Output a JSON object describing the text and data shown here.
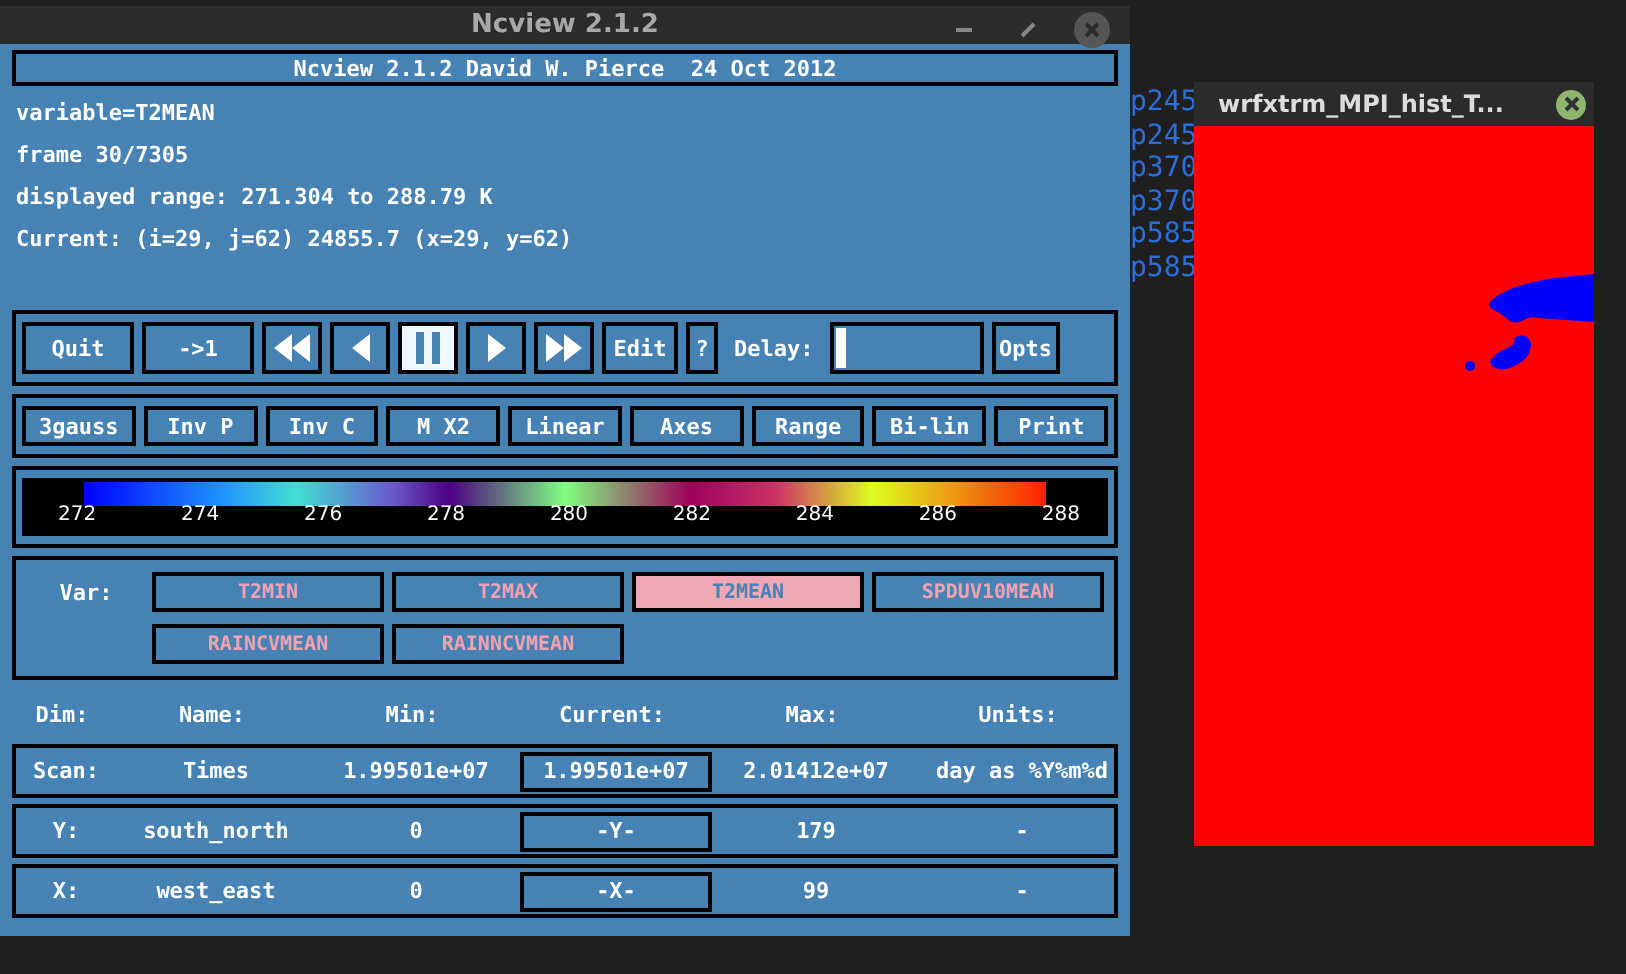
{
  "window": {
    "title": "Ncview 2.1.2"
  },
  "banner": "Ncview 2.1.2 David W. Pierce  24 Oct 2012",
  "info_lines": [
    "variable=T2MEAN",
    "frame 30/7305",
    "displayed range: 271.304 to 288.79 K",
    "Current: (i=29, j=62) 24855.7 (x=29, y=62)"
  ],
  "controls": [
    {
      "kind": "text",
      "label": "Quit"
    },
    {
      "kind": "text",
      "label": "->1"
    },
    {
      "kind": "rewind",
      "selected": false
    },
    {
      "kind": "back",
      "selected": false
    },
    {
      "kind": "pause",
      "selected": true
    },
    {
      "kind": "forward",
      "selected": false
    },
    {
      "kind": "fastforward",
      "selected": false
    },
    {
      "kind": "text",
      "label": "Edit"
    },
    {
      "kind": "text",
      "label": "?"
    },
    {
      "kind": "label",
      "label": "Delay:"
    },
    {
      "kind": "slider",
      "level": 0.04
    },
    {
      "kind": "text",
      "label": "Opts"
    }
  ],
  "options": [
    "3gauss",
    "Inv P",
    "Inv C",
    "M X2",
    "Linear",
    "Axes",
    "Range",
    "Bi-lin",
    "Print"
  ],
  "colorbar": {
    "labels": [
      "272",
      "274",
      "276",
      "278",
      "280",
      "282",
      "284",
      "286",
      "288"
    ]
  },
  "variables": {
    "label": "Var:",
    "items": [
      {
        "name": "T2MIN",
        "selected": false
      },
      {
        "name": "T2MAX",
        "selected": false
      },
      {
        "name": "T2MEAN",
        "selected": true
      },
      {
        "name": "SPDUV10MEAN",
        "selected": false
      },
      {
        "name": "RAINCVMEAN",
        "selected": false
      },
      {
        "name": "RAINNCVMEAN",
        "selected": false
      }
    ]
  },
  "dims": {
    "columns": [
      "Dim:",
      "Name:",
      "Min:",
      "Current:",
      "Max:",
      "Units:"
    ],
    "rows": [
      {
        "dim": "Scan:",
        "name": "Times",
        "min": "1.99501e+07",
        "current": "1.99501e+07",
        "max": "2.01412e+07",
        "units": "day as %Y%m%d"
      },
      {
        "dim": "Y:",
        "name": "south_north",
        "min": "0",
        "current": "-Y-",
        "max": "179",
        "units": "-"
      },
      {
        "dim": "X:",
        "name": "west_east",
        "min": "0",
        "current": "-X-",
        "max": "99",
        "units": "-"
      }
    ]
  },
  "background_text": [
    "p245",
    "p245",
    "p370",
    "p370",
    "p585",
    "p585"
  ],
  "image_window": {
    "title": "wrfxtrm_MPI_hist_T..."
  }
}
